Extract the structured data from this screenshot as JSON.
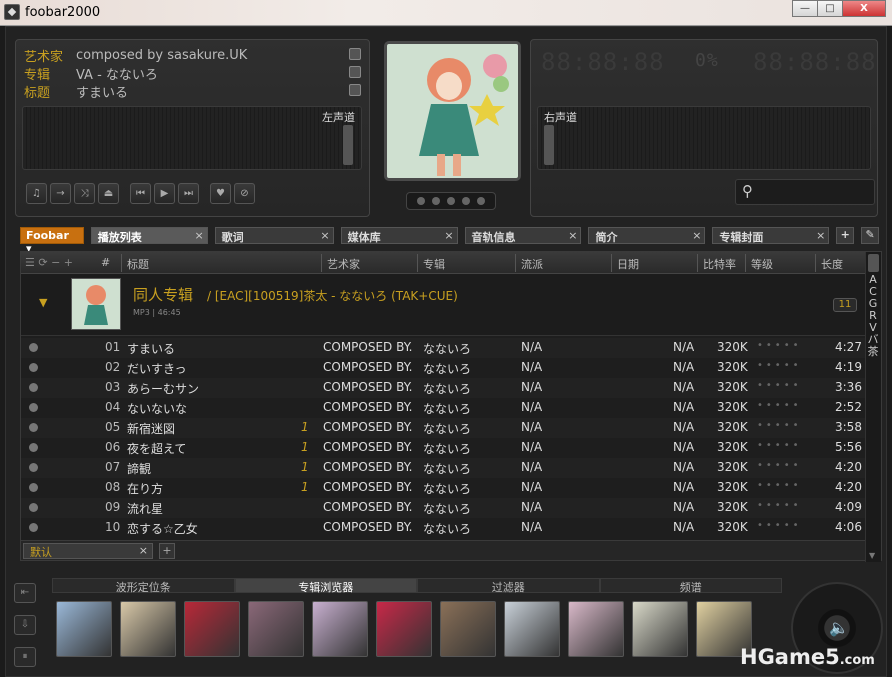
{
  "window": {
    "title": "foobar2000",
    "minimize": "—",
    "maximize": "□",
    "close": "X"
  },
  "now_playing": {
    "artist_label": "艺术家",
    "artist": "composed by sasakure.UK",
    "album_label": "专辑",
    "album": "VA - なないろ",
    "title_label": "标题",
    "title": "すまいる"
  },
  "meters": {
    "left_label": "左声道",
    "right_label": "右声道"
  },
  "lcd": {
    "digits_left": "88:88:88",
    "percent": "0%",
    "digits_right": "88:88:88"
  },
  "controls": [
    "music-icon",
    "next-icon",
    "shuffle-icon",
    "eject-icon",
    "prev-icon",
    "play-icon",
    "fastforward-icon",
    "heart-icon",
    "stop-icon"
  ],
  "tabs": {
    "foobar": "Foobar",
    "items": [
      {
        "label": "播放列表"
      },
      {
        "label": "歌词"
      },
      {
        "label": "媒体库"
      },
      {
        "label": "音轨信息"
      },
      {
        "label": "简介"
      },
      {
        "label": "专辑封面"
      }
    ]
  },
  "columns": {
    "num": "#",
    "title": "标题",
    "artist": "艺术家",
    "album": "专辑",
    "genre": "流派",
    "date": "日期",
    "bitrate": "比特率",
    "rating": "等级",
    "length": "长度"
  },
  "group": {
    "title": "同人专辑",
    "subtitle": "/ [EAC][100519]茶太 - なないろ (TAK+CUE)",
    "meta": "MP3 | 46:45",
    "count": "11"
  },
  "tracks": [
    {
      "no": "01",
      "title": "すまいる",
      "playcount": "",
      "artist": "COMPOSED BY...",
      "album": "なないろ",
      "genre": "N/A",
      "date": "N/A",
      "bitrate": "320K",
      "length": "4:27"
    },
    {
      "no": "02",
      "title": "だいすきっ",
      "playcount": "",
      "artist": "COMPOSED BY...",
      "album": "なないろ",
      "genre": "N/A",
      "date": "N/A",
      "bitrate": "320K",
      "length": "4:19"
    },
    {
      "no": "03",
      "title": "あらーむサン",
      "playcount": "",
      "artist": "COMPOSED BY...",
      "album": "なないろ",
      "genre": "N/A",
      "date": "N/A",
      "bitrate": "320K",
      "length": "3:36"
    },
    {
      "no": "04",
      "title": "ないないな",
      "playcount": "",
      "artist": "COMPOSED BY...",
      "album": "なないろ",
      "genre": "N/A",
      "date": "N/A",
      "bitrate": "320K",
      "length": "2:52"
    },
    {
      "no": "05",
      "title": "新宿迷図",
      "playcount": "1",
      "artist": "COMPOSED BY...",
      "album": "なないろ",
      "genre": "N/A",
      "date": "N/A",
      "bitrate": "320K",
      "length": "3:58"
    },
    {
      "no": "06",
      "title": "夜を超えて",
      "playcount": "1",
      "artist": "COMPOSED BY...",
      "album": "なないろ",
      "genre": "N/A",
      "date": "N/A",
      "bitrate": "320K",
      "length": "5:56"
    },
    {
      "no": "07",
      "title": "諦観",
      "playcount": "1",
      "artist": "COMPOSED BY...",
      "album": "なないろ",
      "genre": "N/A",
      "date": "N/A",
      "bitrate": "320K",
      "length": "4:20"
    },
    {
      "no": "08",
      "title": "在り方",
      "playcount": "1",
      "artist": "COMPOSED BY...",
      "album": "なないろ",
      "genre": "N/A",
      "date": "N/A",
      "bitrate": "320K",
      "length": "4:20"
    },
    {
      "no": "09",
      "title": "流れ星",
      "playcount": "",
      "artist": "COMPOSED BY...",
      "album": "なないろ",
      "genre": "N/A",
      "date": "N/A",
      "bitrate": "320K",
      "length": "4:09"
    },
    {
      "no": "10",
      "title": "恋する☆乙女",
      "playcount": "",
      "artist": "COMPOSED BY...",
      "album": "なないろ",
      "genre": "N/A",
      "date": "N/A",
      "bitrate": "320K",
      "length": "4:06"
    }
  ],
  "alpha_index": [
    "A",
    "C",
    "G",
    "R",
    "V",
    "バ",
    "茶"
  ],
  "playlist_tab": {
    "label": "默认",
    "close": "×",
    "add": "+"
  },
  "bottom_tabs": [
    {
      "label": "波形定位条"
    },
    {
      "label": "专辑浏览器"
    },
    {
      "label": "过滤器"
    },
    {
      "label": "频谱"
    }
  ],
  "album_thumbs": [
    "#9ab8d8",
    "#d8c8a8",
    "#b82838",
    "#8a6878",
    "#c8b0d0",
    "#c82848",
    "#8a7058",
    "#c8d0d8",
    "#d8b8c8",
    "#d8d8c8",
    "#e0d0a0"
  ],
  "watermark": {
    "main": "HGame5",
    "suffix": ".com"
  }
}
